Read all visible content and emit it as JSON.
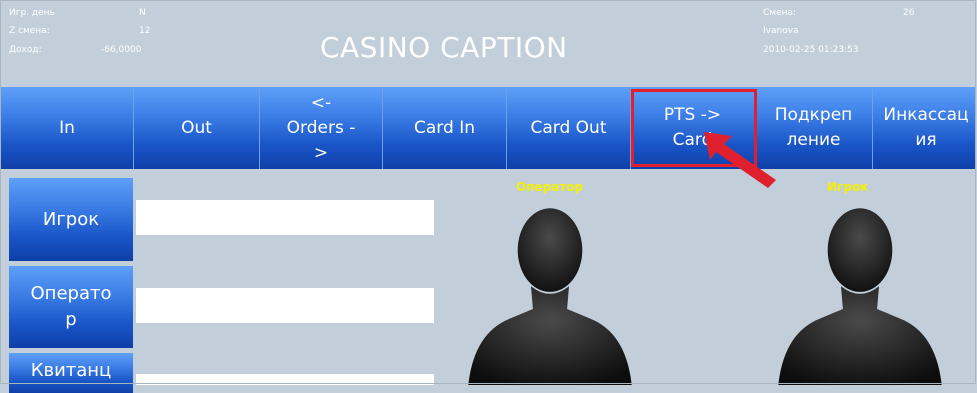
{
  "header": {
    "left_info": [
      {
        "label": "Игр. день",
        "value": "N"
      },
      {
        "label": "Z смена:",
        "value": "12"
      },
      {
        "label": "Доход:",
        "value": "-66,0000"
      }
    ],
    "title": "CASINO CAPTION",
    "right_info": {
      "shift_label": "Смена:",
      "shift_value": "26",
      "operator_name": "Ivanova",
      "datetime": "2010-02-25 01:23:53"
    }
  },
  "menu": [
    {
      "label": "In"
    },
    {
      "label": "Out"
    },
    {
      "label": "<- Orders ->"
    },
    {
      "label": "Card In"
    },
    {
      "label": "Card Out"
    },
    {
      "label": "PTS -> Card"
    },
    {
      "label": "Подкрепление"
    },
    {
      "label": "Инкассация"
    }
  ],
  "side_tabs": [
    {
      "label": "Игрок"
    },
    {
      "label": "Оператор"
    },
    {
      "label": "Квитанц"
    }
  ],
  "fields": [
    {
      "value": ""
    },
    {
      "value": ""
    },
    {
      "value": ""
    }
  ],
  "avatars": {
    "operator_label": "Оператор",
    "player_label": "Игрок"
  },
  "colors": {
    "background": "#c2cfdb",
    "button_top": "#5ea0f8",
    "button_bottom": "#0f3fa8",
    "highlight": "#e0202e",
    "avatar_label": "#f6f000"
  }
}
